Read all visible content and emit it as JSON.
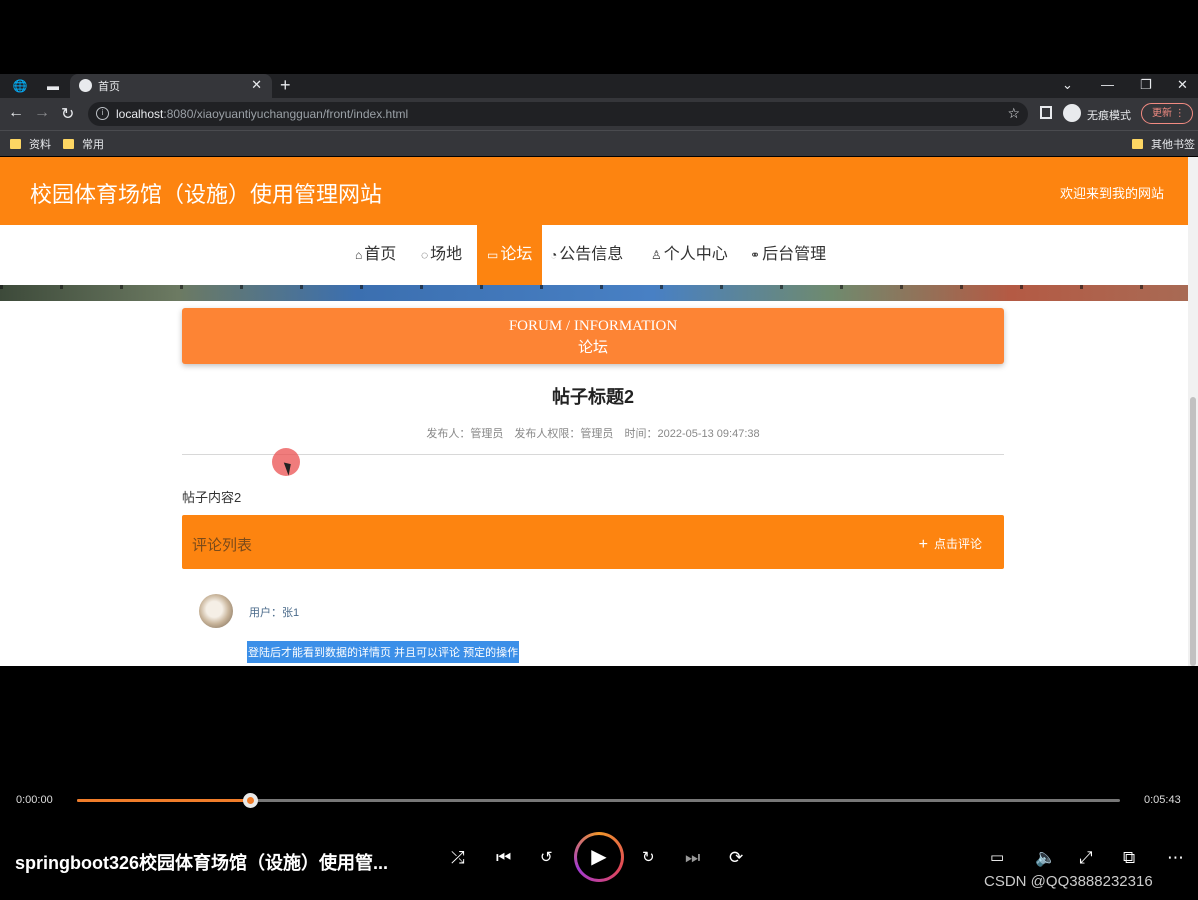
{
  "browser": {
    "tab_title": "首页",
    "url_host": "localhost",
    "url_rest": ":8080/xiaoyuantiyuchangguan/front/index.html",
    "incognito_label": "无痕模式",
    "update_label": "更新",
    "bookmarks": [
      "资料",
      "常用"
    ],
    "other_bookmarks": "其他书签"
  },
  "site": {
    "title": "校园体育场馆（设施）使用管理网站",
    "welcome": "欢迎来到我的网站",
    "nav": [
      {
        "label": "首页",
        "icon": "home-icon"
      },
      {
        "label": "场地",
        "icon": "ball-icon"
      },
      {
        "label": "论坛",
        "icon": "forum-icon",
        "active": true
      },
      {
        "label": "公告信息",
        "icon": "gauge-icon"
      },
      {
        "label": "个人中心",
        "icon": "user-icon"
      },
      {
        "label": "后台管理",
        "icon": "link-icon"
      }
    ]
  },
  "forum_banner": {
    "en": "FORUM / INFORMATION",
    "cn": "论坛"
  },
  "post": {
    "title": "帖子标题2",
    "author": "发布人：管理员",
    "role": "发布人权限：管理员",
    "time": "时间：2022-05-13 09:47:38",
    "content": "帖子内容2"
  },
  "comments": {
    "header": "评论列表",
    "add_label": "点击评论",
    "items": [
      {
        "user": "用户：张1",
        "text": "登陆后才能看到数据的详情页 并且可以评论 预定的操作"
      }
    ]
  },
  "player": {
    "current_time": "0:00:00",
    "total_time": "0:05:43",
    "progress": 0.166,
    "title": "springboot326校园体育场馆（设施）使用管...",
    "watermark": "CSDN @QQ3888232316",
    "accent": "#f07d2a"
  },
  "colors": {
    "brand_orange": "#fd8410",
    "forum_orange": "#fd8434"
  }
}
